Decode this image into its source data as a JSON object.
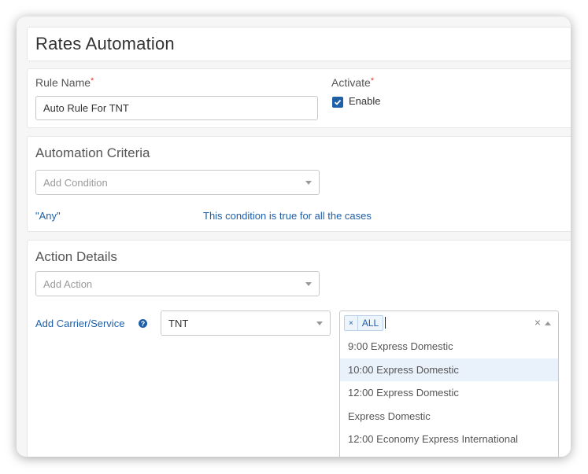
{
  "page": {
    "title": "Rates Automation"
  },
  "rule": {
    "name_label": "Rule Name",
    "required_mark": "*",
    "name_value": "Auto Rule For TNT",
    "activate_label": "Activate",
    "enable_label": "Enable",
    "enable_checked": true
  },
  "criteria": {
    "title": "Automation Criteria",
    "condition_placeholder": "Add Condition",
    "any_label": "\"Any\"",
    "any_description": "This condition is true for all the cases"
  },
  "action": {
    "title": "Action Details",
    "action_placeholder": "Add Action",
    "carrier_label": "Add Carrier/Service",
    "help_icon": "?",
    "carrier_value": "TNT",
    "service_tag": "ALL",
    "tag_remove": "×",
    "clear_icon": "×",
    "service_options": [
      "9:00 Express Domestic",
      "10:00 Express Domestic",
      "12:00 Express Domestic",
      "Express Domestic",
      "12:00 Economy Express International"
    ],
    "highlighted_option_index": 1
  },
  "colors": {
    "accent": "#1e5fa8",
    "required": "#e53935",
    "highlight": "#e9f1fb"
  }
}
